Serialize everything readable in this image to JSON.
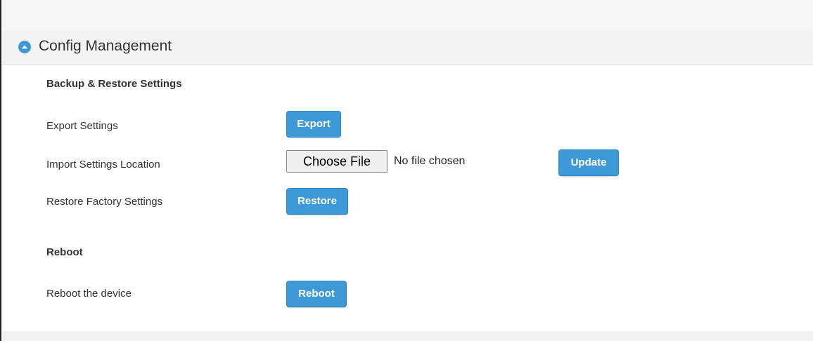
{
  "panel": {
    "title": "Config Management",
    "collapse_icon": "chevron-up-circle-icon",
    "accent_color": "#3e9ad6"
  },
  "backup_restore": {
    "heading": "Backup & Restore Settings",
    "export": {
      "label": "Export Settings",
      "button": "Export"
    },
    "import": {
      "label": "Import Settings Location",
      "choose_file": "Choose File",
      "file_status": "No file chosen",
      "button": "Update"
    },
    "factory": {
      "label": "Restore Factory Settings",
      "button": "Restore"
    }
  },
  "reboot": {
    "heading": "Reboot",
    "label": "Reboot the device",
    "button": "Reboot"
  }
}
